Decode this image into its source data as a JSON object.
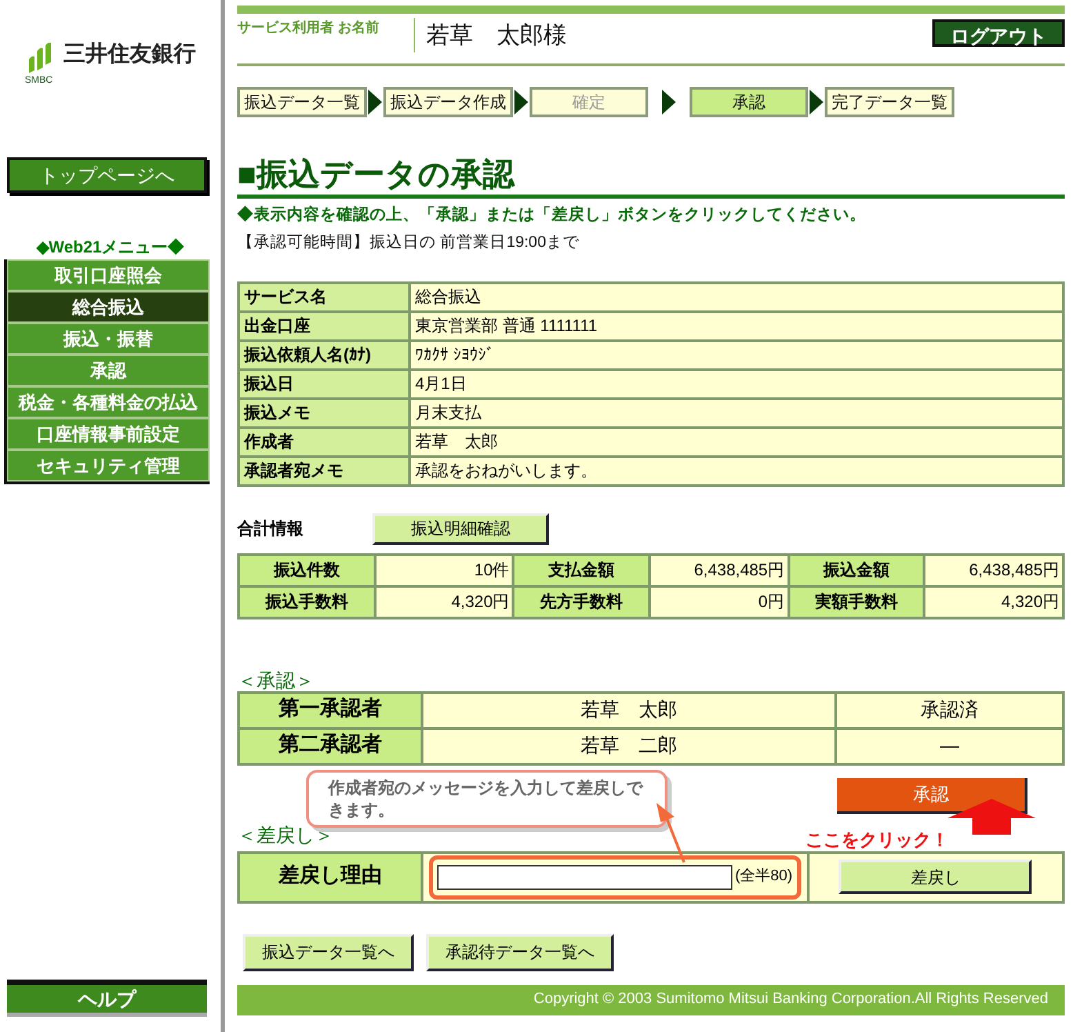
{
  "sidebar": {
    "logo": {
      "brand": "三井住友銀行",
      "abbr": "SMBC"
    },
    "top_button": "トップページへ",
    "menu_title": "◆Web21メニュー◆",
    "menu": [
      {
        "label": "取引口座照会",
        "selected": false
      },
      {
        "label": "総合振込",
        "selected": true
      },
      {
        "label": "振込・振替",
        "selected": false
      },
      {
        "label": "承認",
        "selected": false
      },
      {
        "label": "税金・各種料金の払込",
        "selected": false
      },
      {
        "label": "口座情報事前設定",
        "selected": false
      },
      {
        "label": "セキュリティ管理",
        "selected": false
      }
    ],
    "help_button": "ヘルプ"
  },
  "header": {
    "user_label": "サービス利用者 お名前",
    "user_name": "若草　太郎様",
    "logout": "ログアウト"
  },
  "steps": [
    {
      "label": "振込データ一覧",
      "selected": false,
      "disabled": false
    },
    {
      "label": "振込データ作成",
      "selected": false,
      "disabled": false
    },
    {
      "label": "確定",
      "selected": false,
      "disabled": true
    },
    {
      "label": "承認",
      "selected": true,
      "disabled": false
    },
    {
      "label": "完了データ一覧",
      "selected": false,
      "disabled": false
    }
  ],
  "title": "■振込データの承認",
  "instruction": "◆表示内容を確認の上、「承認」または「差戻し」ボタンをクリックしてください。",
  "time_note": "【承認可能時間】振込日の 前営業日19:00まで",
  "details": [
    {
      "label": "サービス名",
      "value": "総合振込"
    },
    {
      "label": "出金口座",
      "value": "東京営業部 普通 1111111"
    },
    {
      "label": "振込依頼人名(ｶﾅ)",
      "value": "ﾜｶｸｻ ｼﾖｳｼﾞ"
    },
    {
      "label": "振込日",
      "value": "4月1日"
    },
    {
      "label": "振込メモ",
      "value": "月末支払"
    },
    {
      "label": "作成者",
      "value": "若草　太郎"
    },
    {
      "label": "承認者宛メモ",
      "value": "承認をおねがいします。"
    }
  ],
  "totals": {
    "heading": "合計情報",
    "detail_button": "振込明細確認",
    "rows": [
      [
        {
          "label": "振込件数",
          "value": "10件"
        },
        {
          "label": "支払金額",
          "value": "6,438,485円"
        },
        {
          "label": "振込金額",
          "value": "6,438,485円"
        }
      ],
      [
        {
          "label": "振込手数料",
          "value": "4,320円"
        },
        {
          "label": "先方手数料",
          "value": "0円"
        },
        {
          "label": "実額手数料",
          "value": "4,320円"
        }
      ]
    ]
  },
  "approval": {
    "heading": "＜承認＞",
    "rows": [
      {
        "role": "第一承認者",
        "name": "若草　太郎",
        "status": "承認済"
      },
      {
        "role": "第二承認者",
        "name": "若草　二郎",
        "status": "―"
      }
    ],
    "approve_button": "承認",
    "click_hint": "ここをクリック！"
  },
  "callout": "作成者宛のメッセージを入力して差戻しできます。",
  "reject": {
    "heading": "＜差戻し＞",
    "label": "差戻し理由",
    "limit": "(全半80)",
    "button": "差戻し"
  },
  "bottom_buttons": [
    "振込データ一覧へ",
    "承認待データ一覧へ"
  ],
  "footer": "Copyright © 2003 Sumitomo Mitsui Banking Corporation.All Rights Reserved"
}
